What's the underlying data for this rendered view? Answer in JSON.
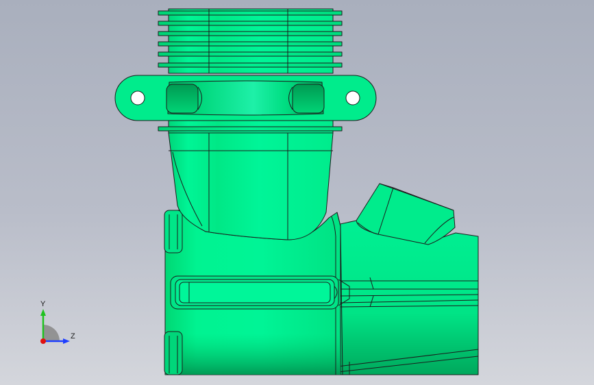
{
  "viewport": {
    "background_top": "#a9afbd",
    "background_bottom": "#d4d6dc"
  },
  "model": {
    "part_color": "#00f08c",
    "edge_color": "#1b1b1b"
  },
  "triad": {
    "y_label": "Y",
    "z_label": "Z",
    "y_color": "#1fc21f",
    "z_color": "#1f3fff",
    "origin_color": "#e01010"
  }
}
